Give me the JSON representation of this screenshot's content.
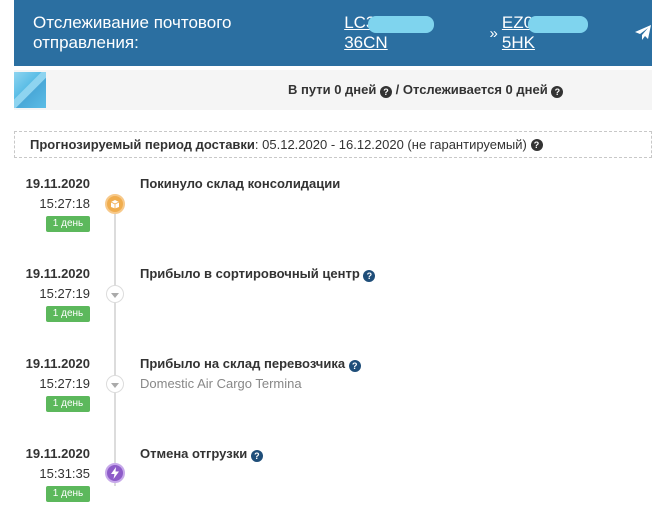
{
  "header": {
    "title": "Отслеживание почтового отправления:",
    "track_from_start": "LC3",
    "track_from_end": "36CN",
    "separator": "»",
    "track_to_start": "EZ0",
    "track_to_end": "5HK",
    "send_icon": "paper-plane-icon"
  },
  "status": {
    "in_transit": "В пути 0 дней",
    "slash": "/",
    "tracked": "Отслеживается 0 дней"
  },
  "forecast": {
    "label": "Прогнозируемый период доставки",
    "value": ": 05.12.2020 - 16.12.2020 (не гарантируемый)"
  },
  "events": [
    {
      "date": "19.11.2020",
      "time": "15:27:18",
      "badge": "1 день",
      "title": "Покинуло склад консолидации",
      "subtitle": "",
      "icon": "box-icon",
      "help": false
    },
    {
      "date": "19.11.2020",
      "time": "15:27:19",
      "badge": "1 день",
      "title": "Прибыло в сортировочный центр",
      "subtitle": "",
      "icon": "chevron-down-icon",
      "help": true
    },
    {
      "date": "19.11.2020",
      "time": "15:27:19",
      "badge": "1 день",
      "title": "Прибыло на склад перевозчика",
      "subtitle": "Domestic Air Cargo Termina",
      "icon": "chevron-down-icon",
      "help": true
    },
    {
      "date": "19.11.2020",
      "time": "15:31:35",
      "badge": "1 день",
      "title": "Отмена отгрузки",
      "subtitle": "",
      "icon": "lightning-icon",
      "help": true
    }
  ],
  "colors": {
    "header_bg": "#2b6fa1",
    "badge_green": "#5cb85c",
    "node_orange": "#f0ad4e",
    "node_purple": "#8e5cc9"
  }
}
